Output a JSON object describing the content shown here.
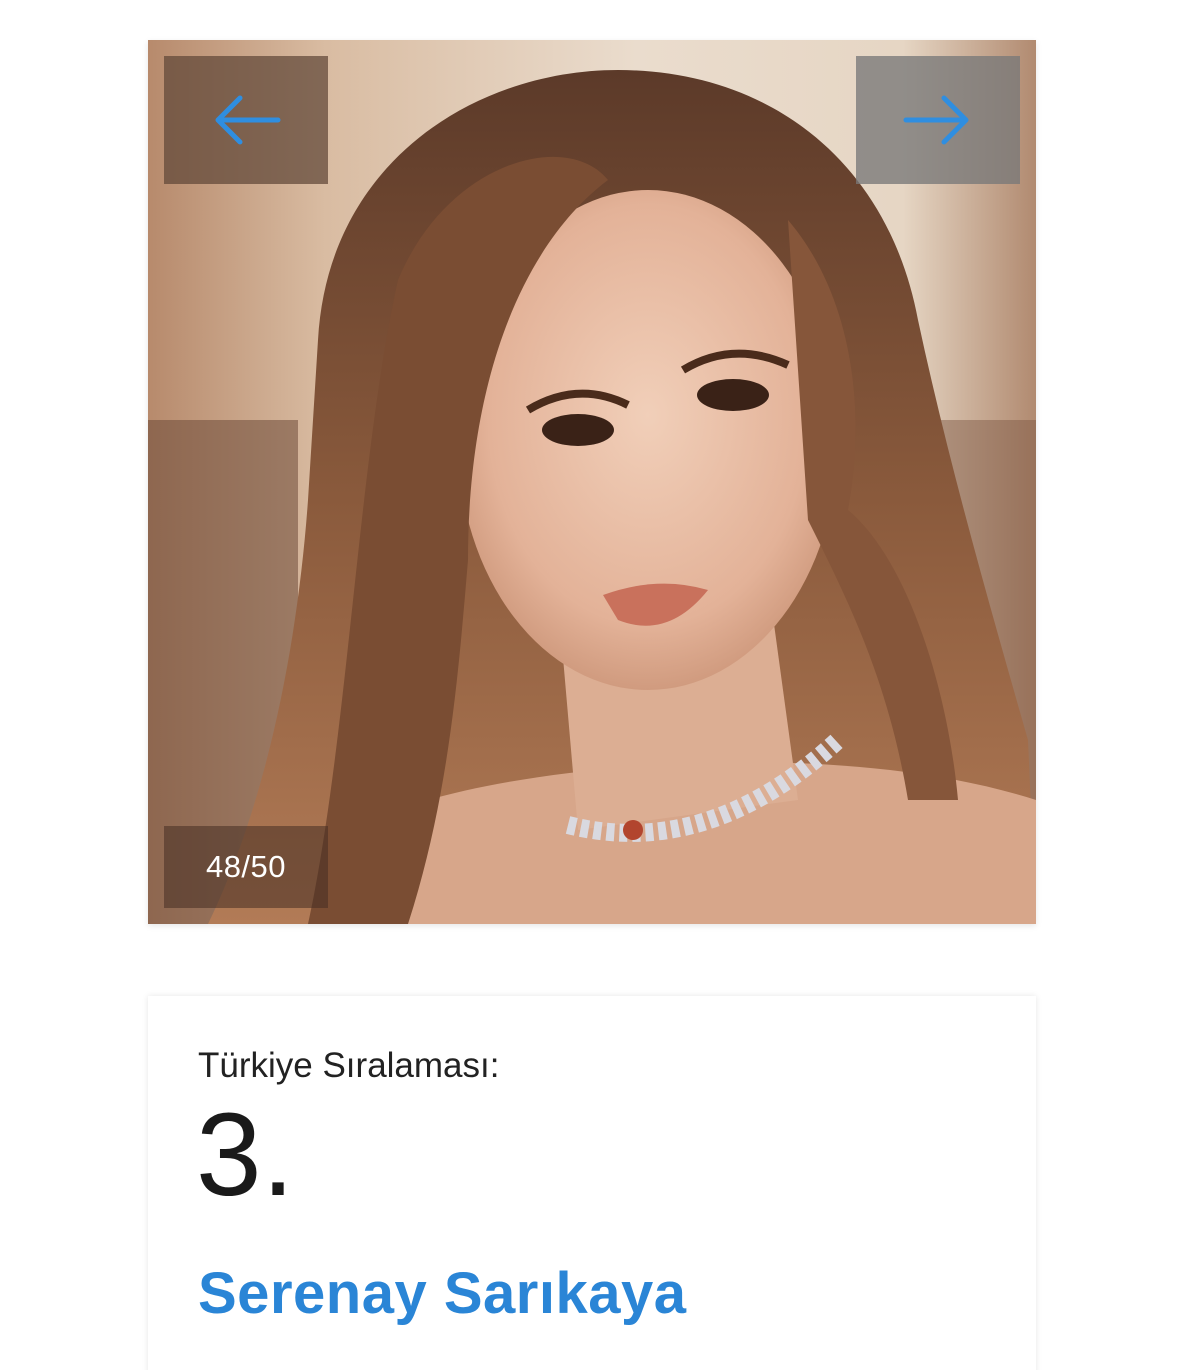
{
  "gallery": {
    "photo_alt": "Serenay Sarıkaya",
    "prev_icon": "arrow-left-icon",
    "next_icon": "arrow-right-icon",
    "counter": "48/50",
    "arrow_color": "#2f8ee0"
  },
  "card": {
    "rank_label": "Türkiye Sıralaması:",
    "rank_value": "3.",
    "name": "Serenay Sarıkaya",
    "name_color": "#2a85d6"
  }
}
